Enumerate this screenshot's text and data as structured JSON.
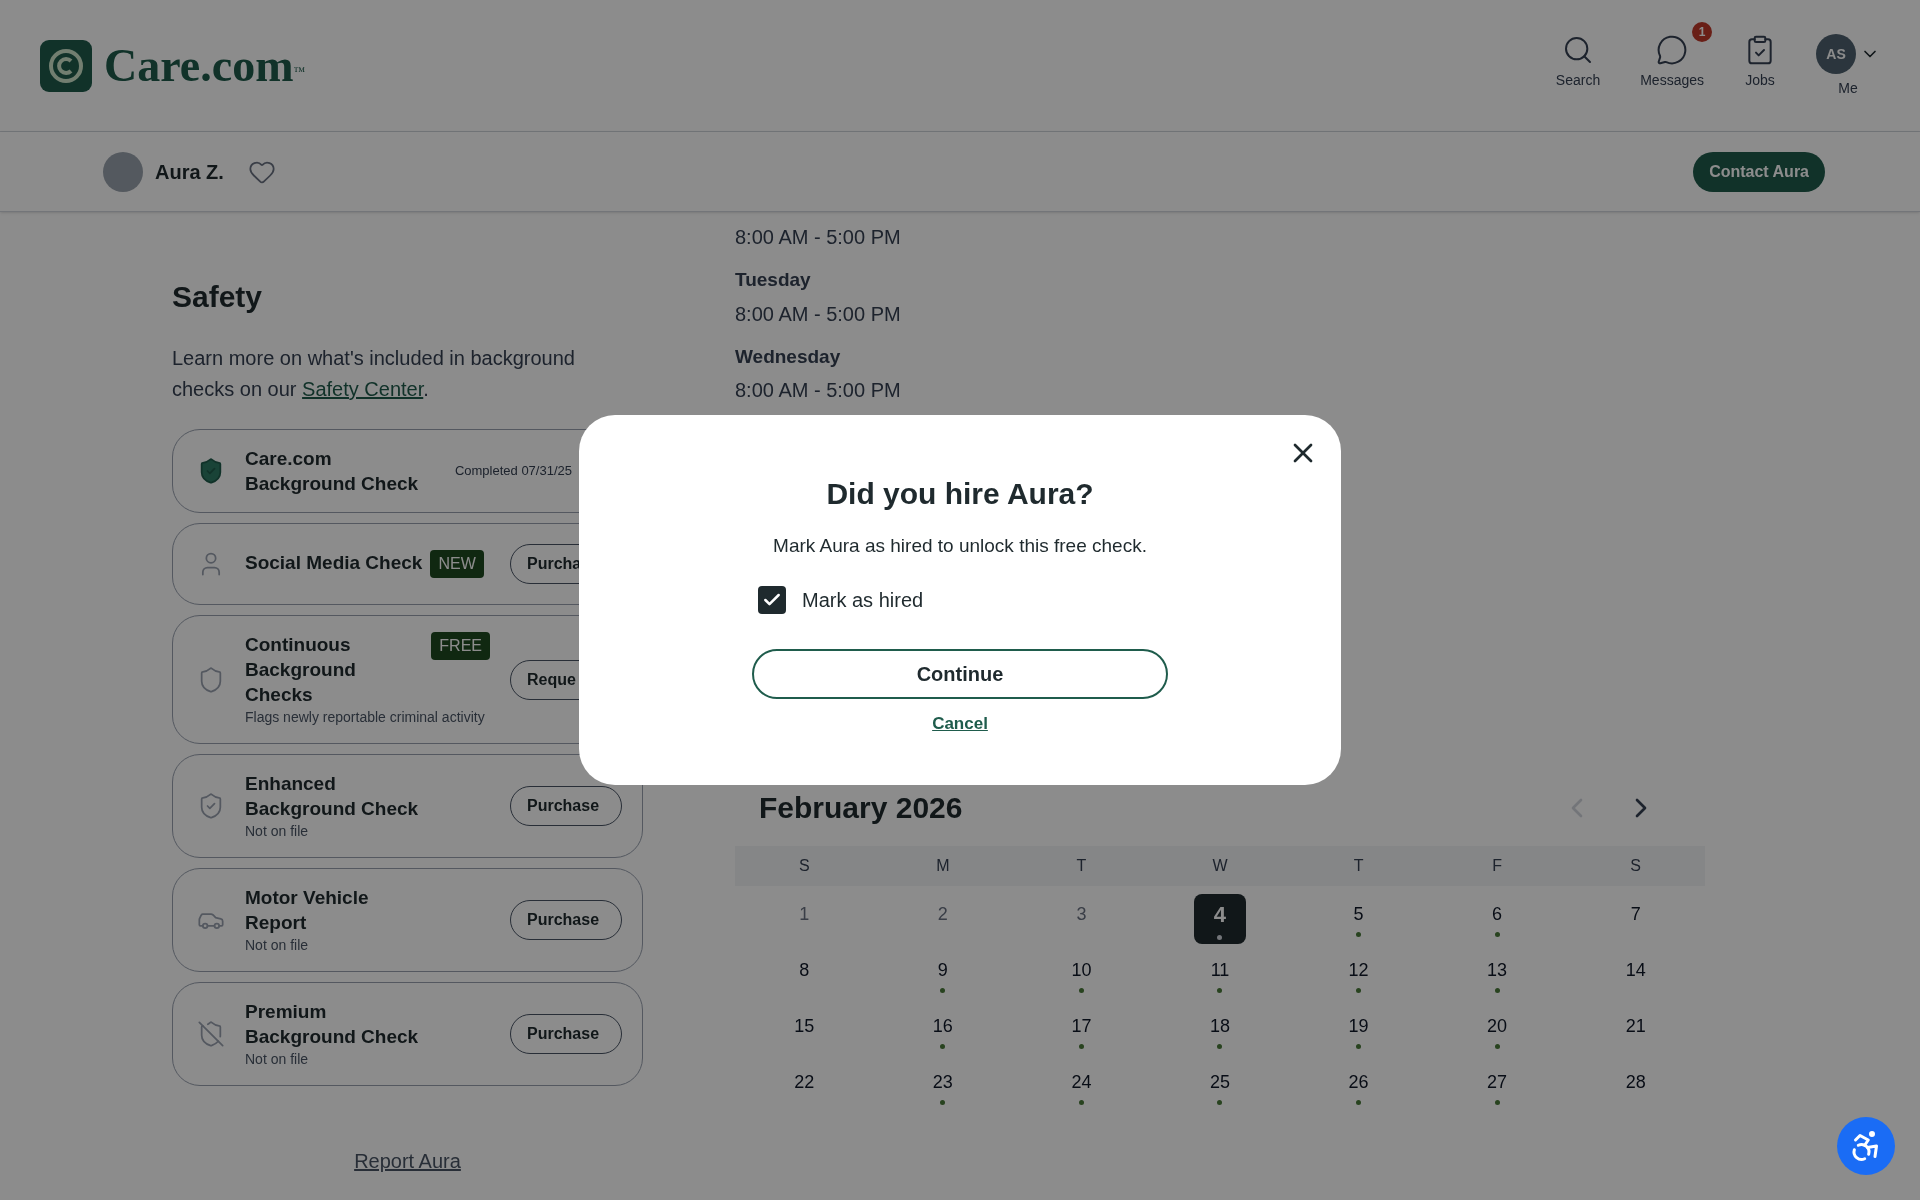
{
  "header": {
    "logo": "Care.com",
    "logo_mark": "™",
    "nav": [
      {
        "label": "Search"
      },
      {
        "label": "Messages",
        "badge": "1"
      },
      {
        "label": "Jobs"
      }
    ],
    "me": {
      "initials": "AS",
      "label": "Me"
    }
  },
  "profile_bar": {
    "name": "Aura Z.",
    "favorited": false,
    "contact_button": "Contact Aura"
  },
  "safety": {
    "title": "Safety",
    "intro": "Learn more on what's included in background checks on our ",
    "link": "Safety Center",
    "intro_end": ".",
    "checks": [
      {
        "title": "Care.com Background Check",
        "status": "Completed 07/31/25",
        "done": true
      },
      {
        "title": "Social Media Check",
        "badge": "NEW",
        "button": "Purcha",
        "done": false
      },
      {
        "title": "Continuous Background Checks",
        "subtitle": "Flags newly reportable criminal activity",
        "badge": "FREE",
        "button": "Reque",
        "done": false
      },
      {
        "title": "Enhanced Background Check",
        "subtitle": "Not on file",
        "button": "Purchase",
        "done": false
      },
      {
        "title": "Motor Vehicle Report",
        "subtitle": "Not on file",
        "button": "Purchase",
        "done": false
      },
      {
        "title": "Premium Background Check",
        "subtitle": "Not on file",
        "button": "Purchase",
        "done": false
      }
    ],
    "report_link": "Report Aura"
  },
  "schedule": [
    {
      "time": "8:00 AM - 5:00 PM"
    },
    {
      "day": "Tuesday",
      "time": "8:00 AM - 5:00 PM"
    },
    {
      "day": "Wednesday",
      "time": "8:00 AM - 5:00 PM"
    }
  ],
  "calendar": {
    "month": "February 2026",
    "weekdays": [
      "S",
      "M",
      "T",
      "W",
      "T",
      "F",
      "S"
    ],
    "days": [
      {
        "label": "1",
        "past": true,
        "available": false,
        "selected": false
      },
      {
        "label": "2",
        "past": true,
        "available": false,
        "selected": false
      },
      {
        "label": "3",
        "past": true,
        "available": false,
        "selected": false
      },
      {
        "label": "4",
        "past": false,
        "available": true,
        "selected": true
      },
      {
        "label": "5",
        "past": false,
        "available": true,
        "selected": false
      },
      {
        "label": "6",
        "past": false,
        "available": true,
        "selected": false
      },
      {
        "label": "7",
        "past": false,
        "available": false,
        "selected": false
      },
      {
        "label": "8",
        "past": false,
        "available": false,
        "selected": false
      },
      {
        "label": "9",
        "past": false,
        "available": true,
        "selected": false
      },
      {
        "label": "10",
        "past": false,
        "available": true,
        "selected": false
      },
      {
        "label": "11",
        "past": false,
        "available": true,
        "selected": false
      },
      {
        "label": "12",
        "past": false,
        "available": true,
        "selected": false
      },
      {
        "label": "13",
        "past": false,
        "available": true,
        "selected": false
      },
      {
        "label": "14",
        "past": false,
        "available": false,
        "selected": false
      },
      {
        "label": "15",
        "past": false,
        "available": false,
        "selected": false
      },
      {
        "label": "16",
        "past": false,
        "available": true,
        "selected": false
      },
      {
        "label": "17",
        "past": false,
        "available": true,
        "selected": false
      },
      {
        "label": "18",
        "past": false,
        "available": true,
        "selected": false
      },
      {
        "label": "19",
        "past": false,
        "available": true,
        "selected": false
      },
      {
        "label": "20",
        "past": false,
        "available": true,
        "selected": false
      },
      {
        "label": "21",
        "past": false,
        "available": false,
        "selected": false
      },
      {
        "label": "22",
        "past": false,
        "available": false,
        "selected": false
      },
      {
        "label": "23",
        "past": false,
        "available": true,
        "selected": false
      },
      {
        "label": "24",
        "past": false,
        "available": true,
        "selected": false
      },
      {
        "label": "25",
        "past": false,
        "available": true,
        "selected": false
      },
      {
        "label": "26",
        "past": false,
        "available": true,
        "selected": false
      },
      {
        "label": "27",
        "past": false,
        "available": true,
        "selected": false
      },
      {
        "label": "28",
        "past": false,
        "available": false,
        "selected": false
      }
    ]
  },
  "dialog": {
    "title": "Did you hire Aura?",
    "message": "Mark Aura as hired to unlock this free check.",
    "checkbox": {
      "label": "Mark as hired",
      "checked": true
    },
    "primary": "Continue",
    "secondary": "Cancel"
  }
}
